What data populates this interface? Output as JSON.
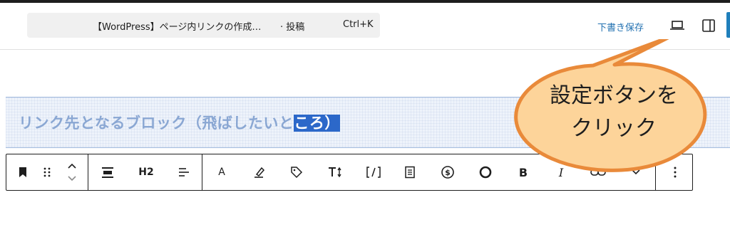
{
  "header": {
    "command_bar": {
      "document_title": "【WordPress】ページ内リンクの作成…",
      "document_type": "· 投稿",
      "shortcut": "Ctrl+K"
    },
    "save_draft_label": "下書き保存",
    "preview_icon": "laptop-icon",
    "settings_icon": "sidebar-toggle-icon",
    "accent_color": "#2271b1"
  },
  "editor": {
    "heading_block": {
      "text_before_selection": "リンク先となるブロック（飛ばしたいと",
      "selected_text": "ころ）",
      "text_color": "#8aa7d3",
      "selection_color": "#2c68c9"
    }
  },
  "block_toolbar": {
    "heading_level_label": "H2",
    "buttons": [
      {
        "name": "bookmark-icon"
      },
      {
        "name": "drag-handle-icon"
      },
      {
        "name": "move-up-down-icon"
      },
      {
        "name": "wide-align-icon"
      },
      {
        "name": "heading-level"
      },
      {
        "name": "text-align-icon"
      },
      {
        "name": "font-a-icon"
      },
      {
        "name": "highlight-pen-icon"
      },
      {
        "name": "tag-icon"
      },
      {
        "name": "text-size-icon"
      },
      {
        "name": "inline-code-icon"
      },
      {
        "name": "document-icon"
      },
      {
        "name": "dollar-circle-icon"
      },
      {
        "name": "circle-icon"
      },
      {
        "name": "bold-icon"
      },
      {
        "name": "italic-icon"
      },
      {
        "name": "link-icon"
      },
      {
        "name": "chevron-down-icon"
      },
      {
        "name": "more-options-icon"
      }
    ],
    "bold_label": "B",
    "italic_label": "I",
    "font_label": "A"
  },
  "callout": {
    "line1": "設定ボタンを",
    "line2": "クリック",
    "fill_color": "#fdd49a",
    "stroke_color": "#e98a3a"
  }
}
